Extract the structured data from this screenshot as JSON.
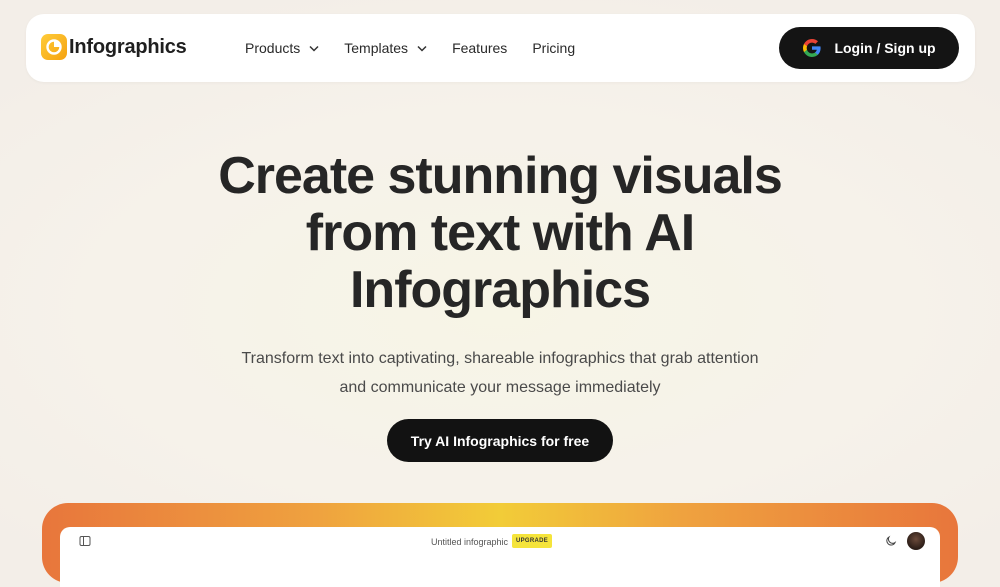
{
  "header": {
    "logo_text": "Infographics",
    "nav": [
      {
        "label": "Products",
        "has_dropdown": true
      },
      {
        "label": "Templates",
        "has_dropdown": true
      },
      {
        "label": "Features",
        "has_dropdown": false
      },
      {
        "label": "Pricing",
        "has_dropdown": false
      }
    ],
    "login_label": "Login / Sign up"
  },
  "hero": {
    "title_line1": "Create stunning visuals",
    "title_line2": "from text with AI",
    "title_line3": "Infographics",
    "subtitle_line1": "Transform text into captivating, shareable infographics that grab attention",
    "subtitle_line2": "and communicate your message immediately",
    "cta_label": "Try AI Infographics for free"
  },
  "preview": {
    "doc_title": "Untitled infographic",
    "badge": "UPGRADE"
  },
  "colors": {
    "accent_yellow": "#f5a20f",
    "button_dark": "#141414",
    "upgrade_badge": "#f5e43b"
  }
}
